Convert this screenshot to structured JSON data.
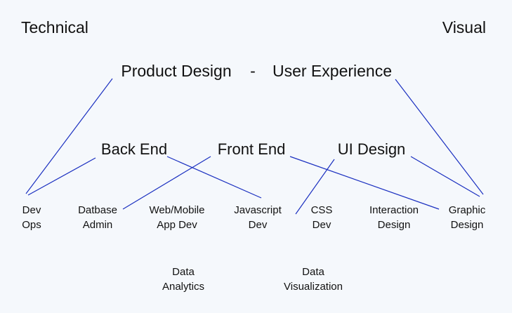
{
  "corners": {
    "left": "Technical",
    "right": "Visual"
  },
  "top_row": {
    "left": "Product Design",
    "separator": "-",
    "right": "User Experience"
  },
  "middle_row": {
    "back_end": "Back End",
    "front_end": "Front End",
    "ui_design": "UI Design"
  },
  "leaves": {
    "dev_ops": [
      "Dev",
      "Ops"
    ],
    "database_admin": [
      "Datbase",
      "Admin"
    ],
    "web_mobile_app_dev": [
      "Web/Mobile",
      "App Dev"
    ],
    "javascript_dev": [
      "Javascript",
      "Dev"
    ],
    "css_dev": [
      "CSS",
      "Dev"
    ],
    "interaction_design": [
      "Interaction",
      "Design"
    ],
    "graphic_design": [
      "Graphic",
      "Design"
    ]
  },
  "bottom_row": {
    "data_analytics": [
      "Data",
      "Analytics"
    ],
    "data_visualization": [
      "Data",
      "Visualization"
    ]
  },
  "line_color": "#1a2fc0"
}
